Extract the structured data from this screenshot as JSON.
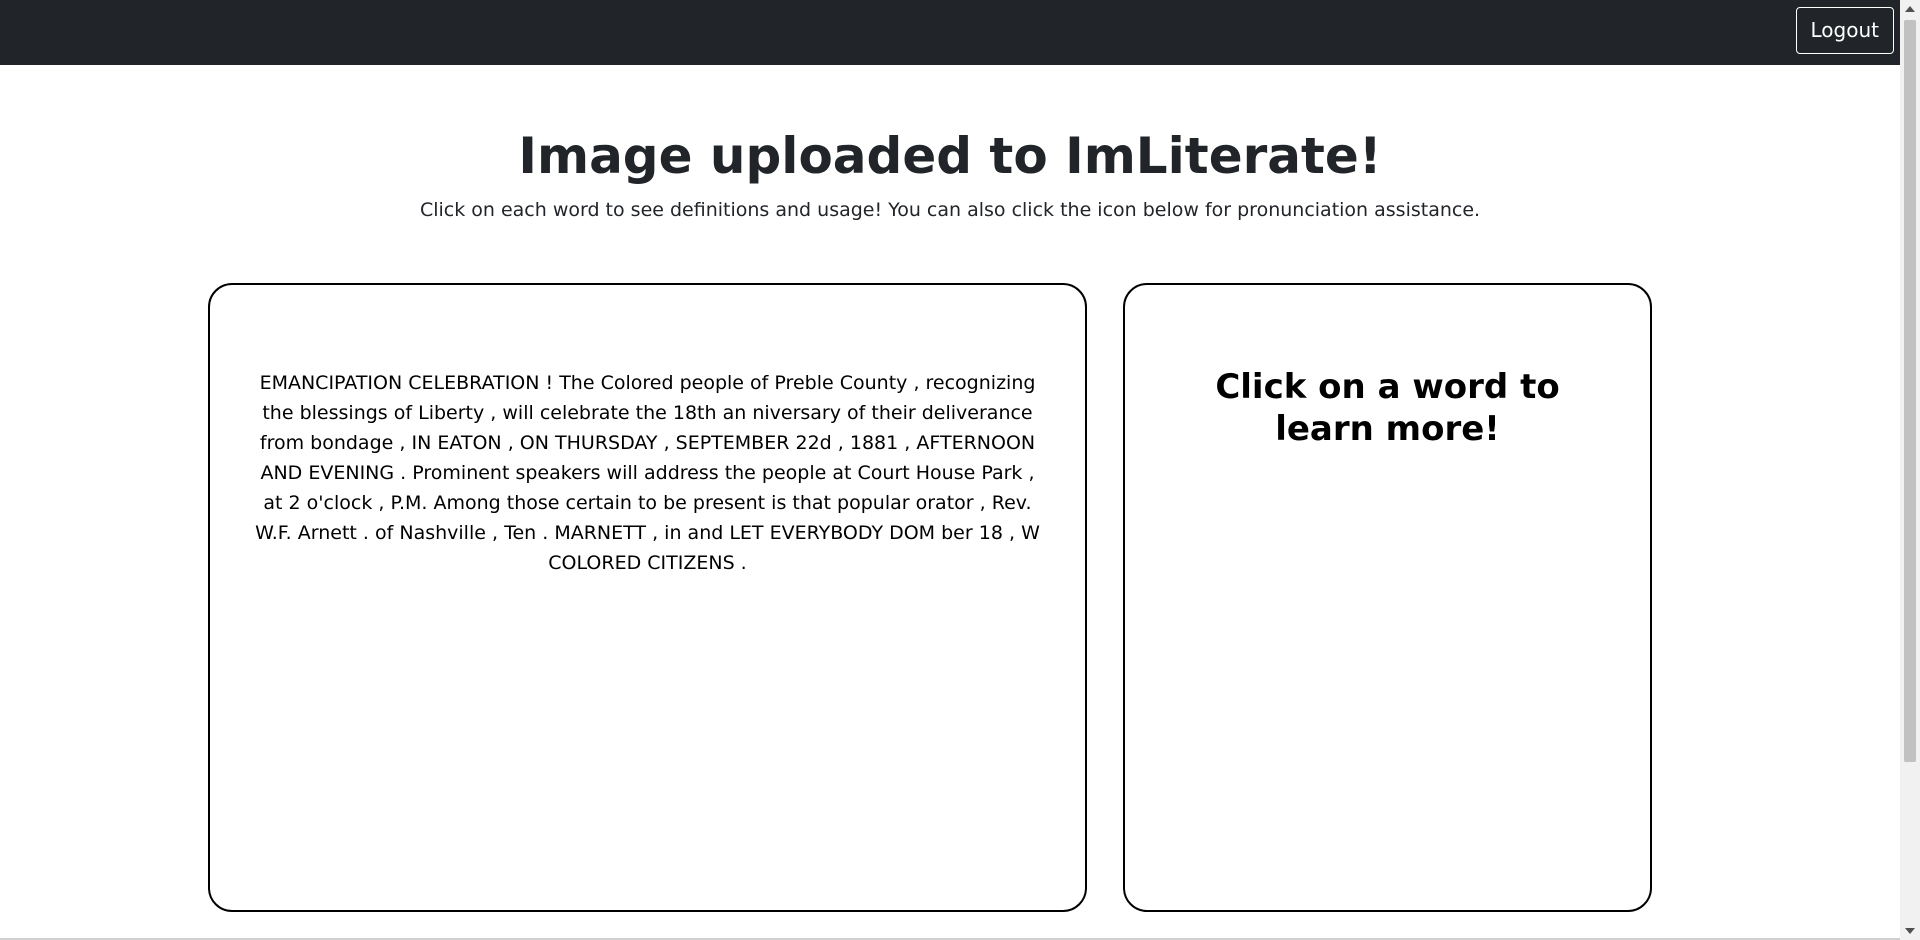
{
  "navbar": {
    "logout_label": "Logout"
  },
  "header": {
    "title": "Image uploaded to ImLiterate!",
    "subtitle": "Click on each word to see definitions and usage! You can also click the icon below for pronunciation assistance."
  },
  "text_card": {
    "words": [
      "EMANCIPATION",
      "CELEBRATION",
      "!",
      "The",
      "Colored",
      "people",
      "of",
      "Preble",
      "County",
      ",",
      "recognizing",
      "the",
      "blessings",
      "of",
      "Liberty",
      ",",
      "will",
      "celebrate",
      "the",
      "18th",
      "an",
      "niversary",
      "of",
      "their",
      "deliverance",
      "from",
      "bondage",
      ",",
      "IN",
      "EATON",
      ",",
      "ON",
      "THURSDAY",
      ",",
      "SEPTEMBER",
      "22d",
      ",",
      "1881",
      ",",
      "AFTERNOON",
      "AND",
      "EVENING",
      ".",
      "Prominent",
      "speakers",
      "will",
      "address",
      "the",
      "people",
      "at",
      "Court",
      "House",
      "Park",
      ",",
      "at",
      "2",
      "o'clock",
      ",",
      "P.M.",
      "Among",
      "those",
      "certain",
      "to",
      "be",
      "present",
      "is",
      "that",
      "popular",
      "orator",
      ",",
      "Rev.",
      "W.F.",
      "Arnett",
      ".",
      "of",
      "Nashville",
      ",",
      "Ten",
      ".",
      "MARNETT",
      ",",
      "in",
      "and",
      "LET",
      "EVERYBODY",
      "DOM",
      "ber",
      "18",
      ",",
      "W",
      "COLORED",
      "CITIZENS",
      "."
    ]
  },
  "info_card": {
    "heading": "Click on a word to learn more!"
  },
  "colors": {
    "navbar_bg": "#212529",
    "card_border": "#000000",
    "text": "#212529"
  }
}
